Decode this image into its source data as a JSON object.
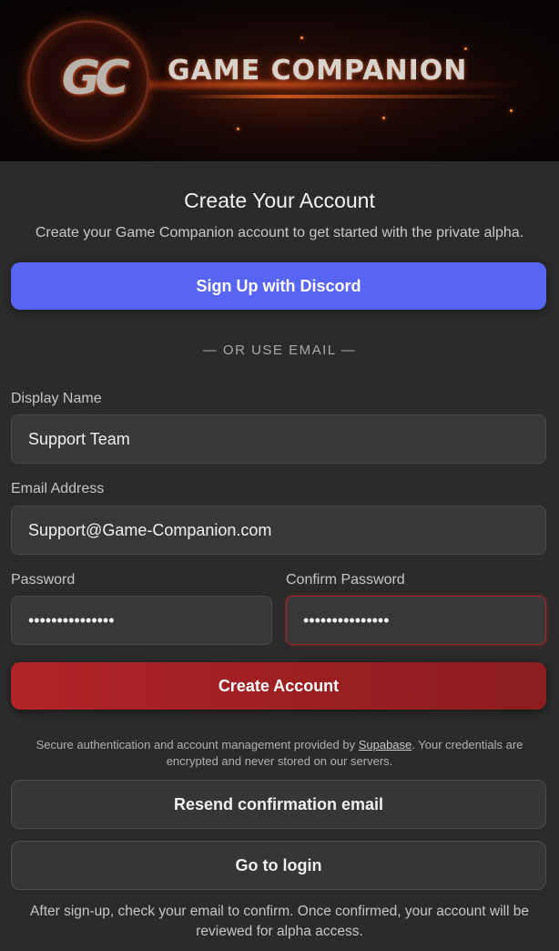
{
  "banner": {
    "logo_mark": "GC",
    "brand_title": "GAME COMPANION"
  },
  "heading": "Create Your Account",
  "subheading": "Create your Game Companion account to get started with the private alpha.",
  "discord_button": "Sign Up with Discord",
  "divider": "— OR USE EMAIL —",
  "form": {
    "display_name": {
      "label": "Display Name",
      "value": "Support Team"
    },
    "email": {
      "label": "Email Address",
      "value": "Support@Game-Companion.com"
    },
    "password": {
      "label": "Password",
      "value": "•••••••••••••••"
    },
    "confirm_password": {
      "label": "Confirm Password",
      "value": "•••••••••••••••"
    }
  },
  "create_button": "Create Account",
  "secure_note": {
    "before": "Secure authentication and account management provided by ",
    "link": "Supabase",
    "after": ". Your credentials are encrypted and never stored on our servers."
  },
  "resend_button": "Resend confirmation email",
  "login_button": "Go to login",
  "footer": "After sign-up, check your email to confirm. Once confirmed, your account will be reviewed for alpha access.",
  "colors": {
    "discord": "#5865f2",
    "create": "#b32428",
    "background": "#2b2b2b"
  }
}
